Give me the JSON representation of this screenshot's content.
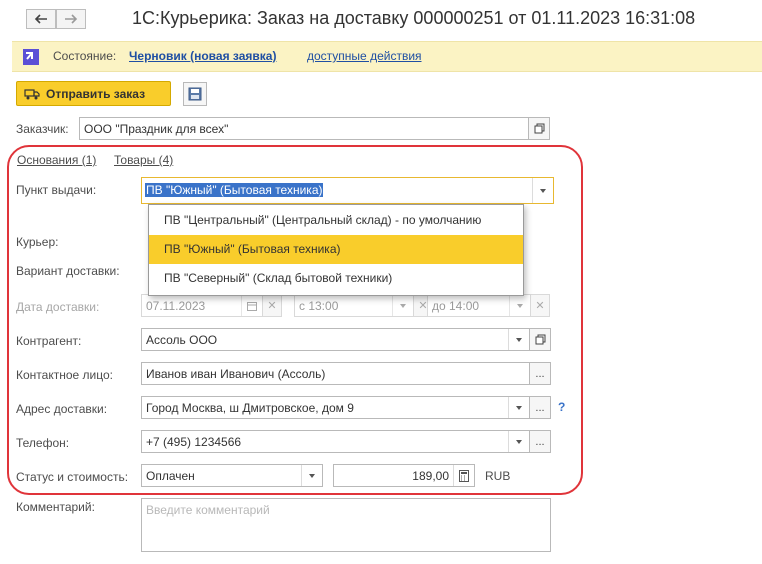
{
  "window": {
    "title": "1С:Курьерика: Заказ на доставку 000000251 от 01.11.2023 16:31:08"
  },
  "status": {
    "label": "Состояние:",
    "value": "Черновик (новая заявка)",
    "actions": "доступные действия"
  },
  "toolbar": {
    "send_label": "Отправить заказ"
  },
  "customer": {
    "label": "Заказчик:",
    "value": "ООО \"Праздник для всех\""
  },
  "tabs": [
    {
      "label": "Основания (1)"
    },
    {
      "label": "Товары (4)"
    }
  ],
  "pickup": {
    "label": "Пункт выдачи:",
    "value": "ПВ \"Южный\" (Бытовая техника)",
    "options": [
      "ПВ \"Центральный\" (Центральный склад) - по умолчанию",
      "ПВ \"Южный\" (Бытовая техника)",
      "ПВ \"Северный\" (Склад бытовой техники)"
    ],
    "selected_index": 1
  },
  "courier": {
    "label": "Курьер:"
  },
  "delivery_variant": {
    "label": "Вариант доставки:"
  },
  "delivery_date": {
    "label": "Дата доставки:",
    "date": "07.11.2023",
    "from": "с 13:00",
    "to": "до 14:00"
  },
  "counterparty": {
    "label": "Контрагент:",
    "value": "Ассоль ООО"
  },
  "contact": {
    "label": "Контактное лицо:",
    "value": "Иванов иван Иванович (Ассоль)"
  },
  "address": {
    "label": "Адрес доставки:",
    "value": "Город Москва, ш Дмитровское, дом 9",
    "help": "?"
  },
  "phone": {
    "label": "Телефон:",
    "value": "+7 (495) 1234566"
  },
  "status_cost": {
    "label": "Статус и стоимость:",
    "status": "Оплачен",
    "amount": "189,00",
    "currency": "RUB"
  },
  "comment": {
    "label": "Комментарий:",
    "placeholder": "Введите комментарий"
  },
  "colors": {
    "accent_yellow": "#f9cd2b",
    "status_bg": "#fbf3c4",
    "link_blue": "#1f4fa3",
    "highlight_frame": "#e0343a",
    "selection_blue": "#3a73c9"
  }
}
